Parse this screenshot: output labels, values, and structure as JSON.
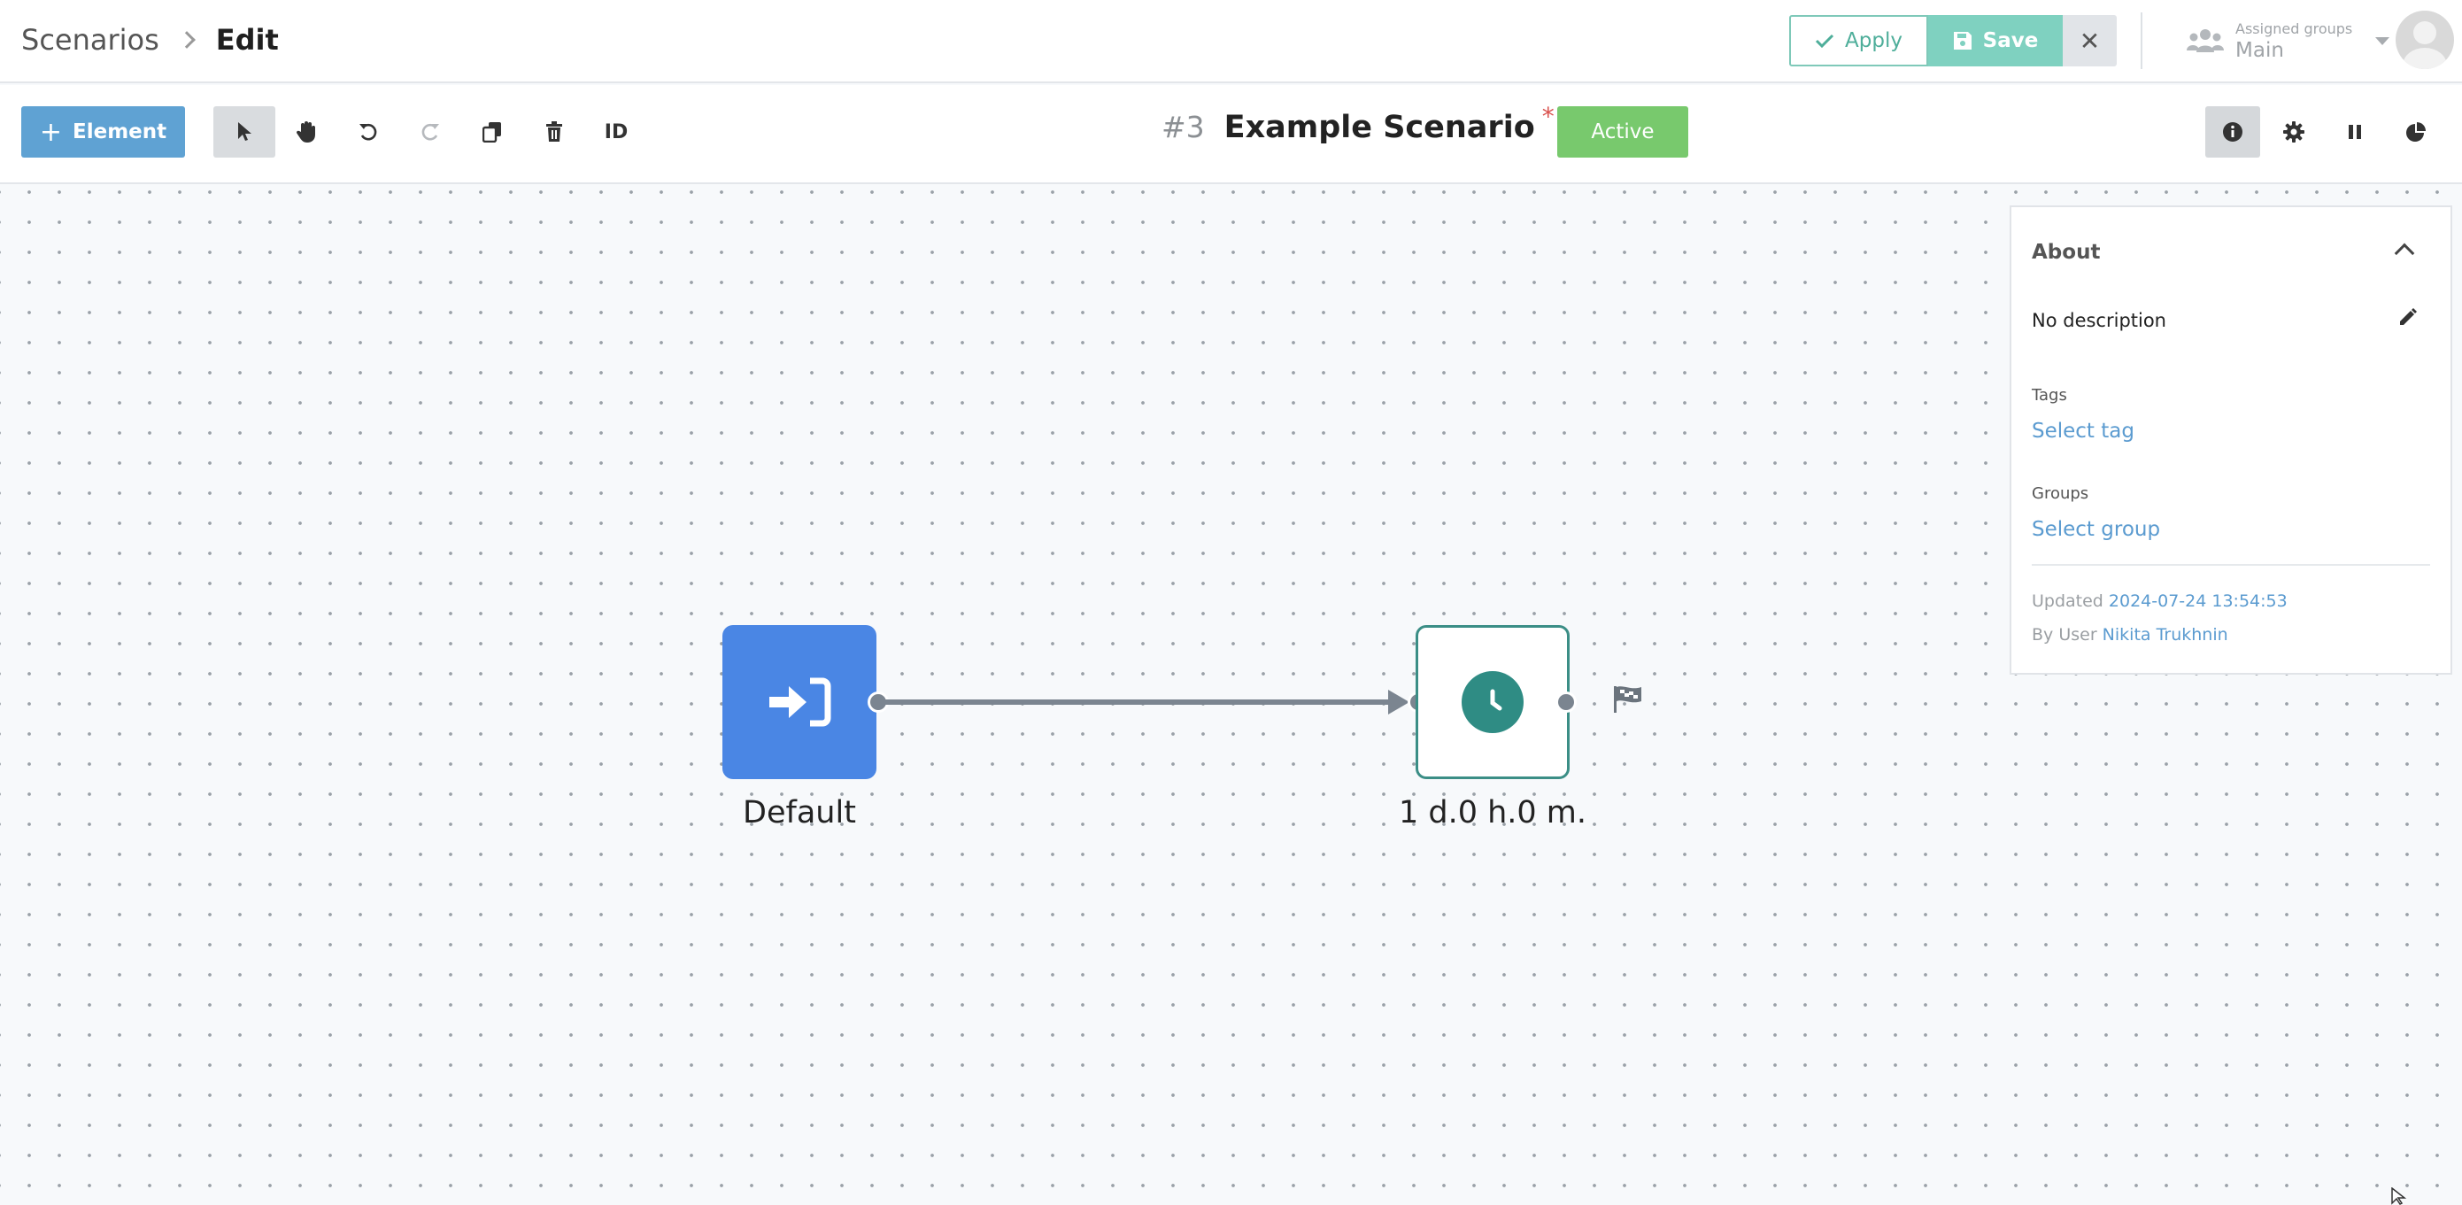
{
  "header": {
    "breadcrumb_root": "Scenarios",
    "breadcrumb_current": "Edit",
    "apply_label": "Apply",
    "save_label": "Save",
    "assigned_groups_label": "Assigned groups",
    "assigned_groups_value": "Main"
  },
  "toolbar": {
    "add_element_label": "Element",
    "id_tool_label": "ID",
    "scenario_number": "#3",
    "scenario_name": "Example Scenario",
    "unsaved_marker": "*",
    "status_label": "Active",
    "tools": [
      "select-pointer",
      "pan-hand",
      "undo",
      "redo (disabled)",
      "copy",
      "delete",
      "id"
    ]
  },
  "canvas": {
    "start_node_label": "Default",
    "timer_node_label": "1 d.0 h.0 m."
  },
  "about": {
    "title": "About",
    "description": "No description",
    "tags_label": "Tags",
    "tags_link": "Select tag",
    "groups_label": "Groups",
    "groups_link": "Select group",
    "updated_label": "Updated",
    "updated_value": "2024-07-24 13:54:53",
    "by_user_label": "By User",
    "by_user_value": "Nikita Trukhnin"
  },
  "colors": {
    "accent_blue": "#4a86e4",
    "link_blue": "#5b9bd0",
    "active_green": "#78c96d",
    "timer_teal": "#2f8c84",
    "save_teal": "#7fd1c0"
  }
}
